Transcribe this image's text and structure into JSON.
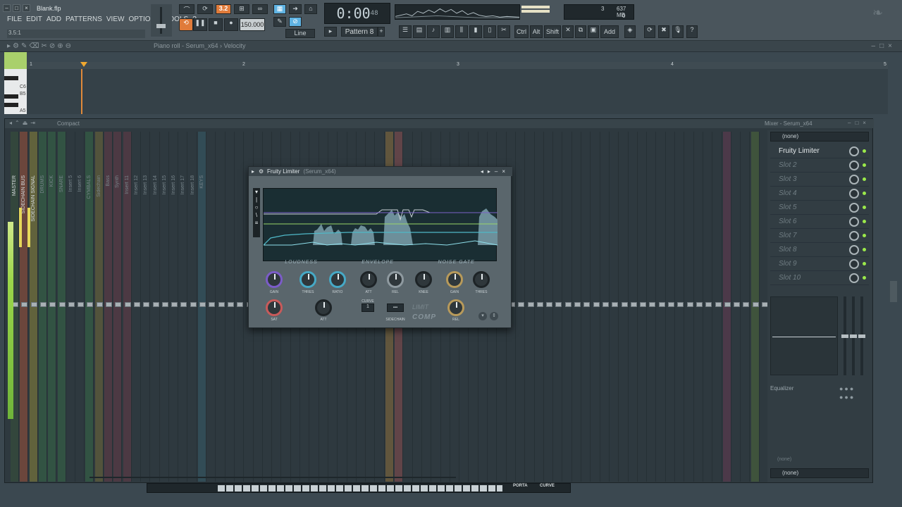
{
  "app": {
    "file_name": "Blank.flp",
    "hint": "3.5:1"
  },
  "menu": [
    "FILE",
    "EDIT",
    "ADD",
    "PATTERNS",
    "VIEW",
    "OPTIONS",
    "TOOLS",
    "?"
  ],
  "transport": {
    "time": "0:00",
    "time_sub": "48",
    "time_unit": "M:S:CS",
    "tempo": "150.000",
    "snap": "Line",
    "pattern": "Pattern 8",
    "pattern_counter": "3.2"
  },
  "cpu": {
    "voices": "3",
    "memory": "637 MB",
    "value": "0"
  },
  "toolbar": {
    "ctrl": "Ctrl",
    "alt": "Alt",
    "shift": "Shift",
    "add": "Add"
  },
  "piano_roll": {
    "title": "Piano roll - Serum_x64 › Velocity",
    "keys": [
      "C6",
      "B5",
      "A5"
    ],
    "bars": [
      "1",
      "2",
      "3",
      "4",
      "5"
    ]
  },
  "mixer": {
    "title": "Mixer - Serum_x64",
    "view": "Compact",
    "insert_names": [
      "MASTER",
      "SIDECHAIN BUS",
      "SIDECHAIN SIGNAL",
      "DRUMS",
      "KICK",
      "SNARE",
      "Insert 5",
      "Insert 6",
      "CYMBALS",
      "Sidechain",
      "Bass",
      "Synth",
      "Insert 11",
      "Insert 12",
      "Insert 13",
      "Insert 14",
      "Insert 15",
      "Insert 16",
      "Insert 17",
      "Insert 18",
      "KEYS"
    ],
    "input": "(none)",
    "output": "(none)",
    "slots": [
      "Fruity Limiter",
      "Slot 2",
      "Slot 3",
      "Slot 4",
      "Slot 5",
      "Slot 6",
      "Slot 7",
      "Slot 8",
      "Slot 9",
      "Slot 10"
    ],
    "equalizer_label": "Equalizer",
    "send_none": "(none)"
  },
  "plugin": {
    "name": "Fruity Limiter",
    "host": "(Serum_x64)",
    "sections": [
      "LOUDNESS",
      "ENVELOPE",
      "NOISE GATE"
    ],
    "knob_labels": [
      "GAIN",
      "THRES",
      "RATIO",
      "ATT",
      "REL",
      "KNEE",
      "GAIN",
      "THRES",
      "SAT",
      "ATT",
      "REL"
    ],
    "comp_label": "COMP",
    "limit_label": "LIMIT",
    "curve_label": "CURVE",
    "sidechain_label": "SIDECHAIN"
  },
  "footer": {
    "porta": "PORTA",
    "curve": "CURVE"
  },
  "colors": {
    "accent_orange": "#e07b3a",
    "slot_led": "#9be94a",
    "meter_green": "#9bd64a",
    "panel": "#2e393f"
  }
}
